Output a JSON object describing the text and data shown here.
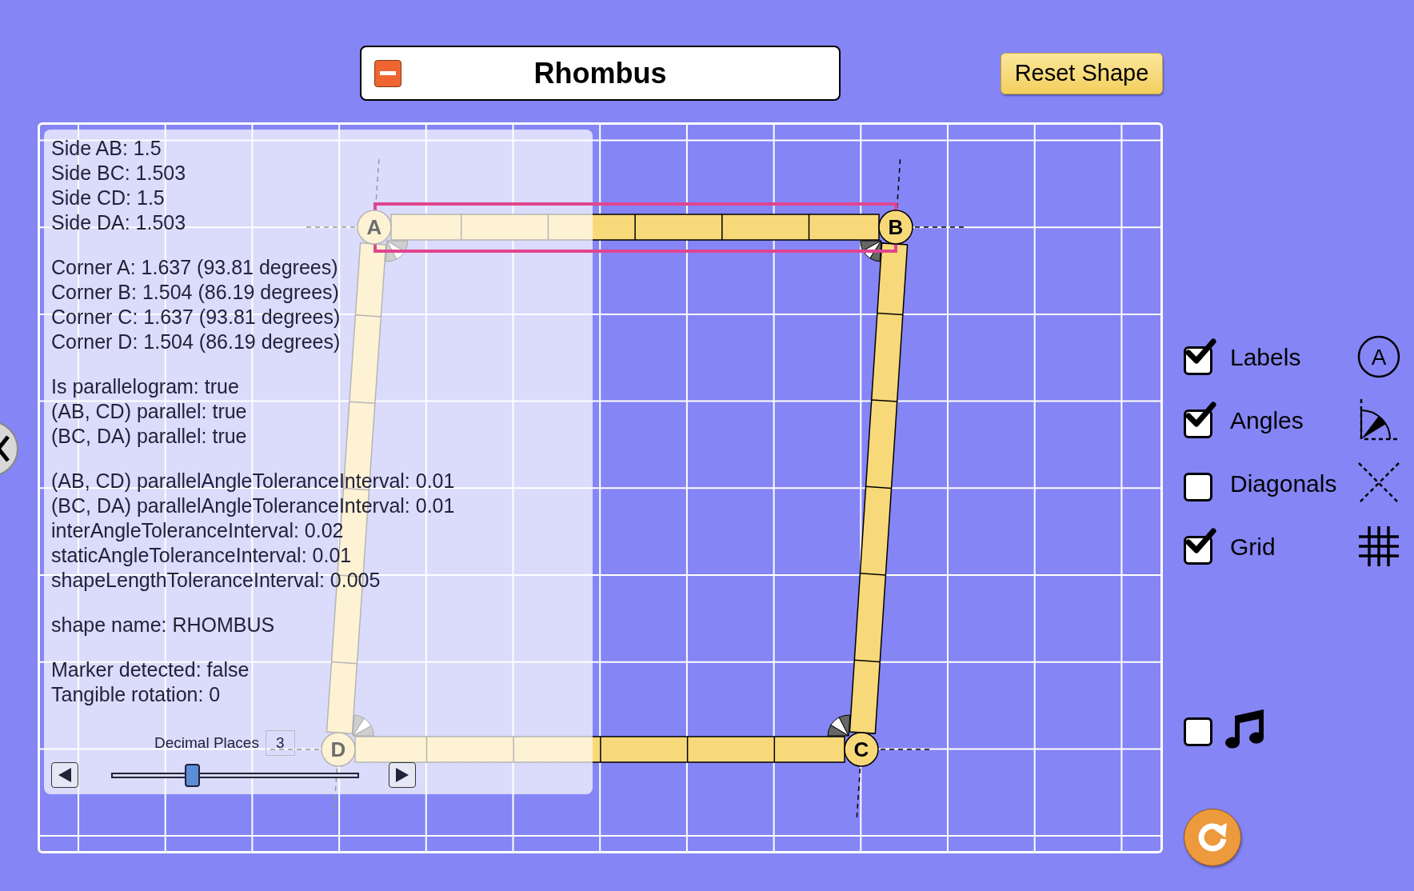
{
  "title_bar": {
    "shape_name": "Rhombus"
  },
  "reset_shape_button": {
    "label": "Reset Shape"
  },
  "debug_panel": {
    "groups": [
      [
        "Side AB: 1.5",
        "Side BC: 1.503",
        "Side CD: 1.5",
        "Side DA: 1.503"
      ],
      [
        "Corner A: 1.637 (93.81 degrees)",
        "Corner B: 1.504 (86.19 degrees)",
        "Corner C: 1.637 (93.81 degrees)",
        "Corner D: 1.504 (86.19 degrees)"
      ],
      [
        "Is parallelogram: true",
        "(AB, CD) parallel: true",
        "(BC, DA) parallel: true"
      ],
      [
        "(AB, CD) parallelAngleToleranceInterval: 0.01",
        "(BC, DA) parallelAngleToleranceInterval: 0.01",
        "interAngleToleranceInterval: 0.02",
        "staticAngleToleranceInterval: 0.01",
        "shapeLengthToleranceInterval: 0.005"
      ],
      [
        "shape name: RHOMBUS"
      ],
      [
        "Marker detected: false",
        "Tangible rotation: 0"
      ]
    ],
    "decimal_places": {
      "label": "Decimal Places",
      "value": "3",
      "level": 0.33
    }
  },
  "shape": {
    "vertices": [
      {
        "label": "A"
      },
      {
        "label": "B"
      },
      {
        "label": "C"
      },
      {
        "label": "D"
      }
    ]
  },
  "options": [
    {
      "label": "Labels",
      "checked": true,
      "icon_letter": "A"
    },
    {
      "label": "Angles",
      "checked": true
    },
    {
      "label": "Diagonals",
      "checked": false
    },
    {
      "label": "Grid",
      "checked": true
    }
  ],
  "sound": {
    "checked": false
  }
}
